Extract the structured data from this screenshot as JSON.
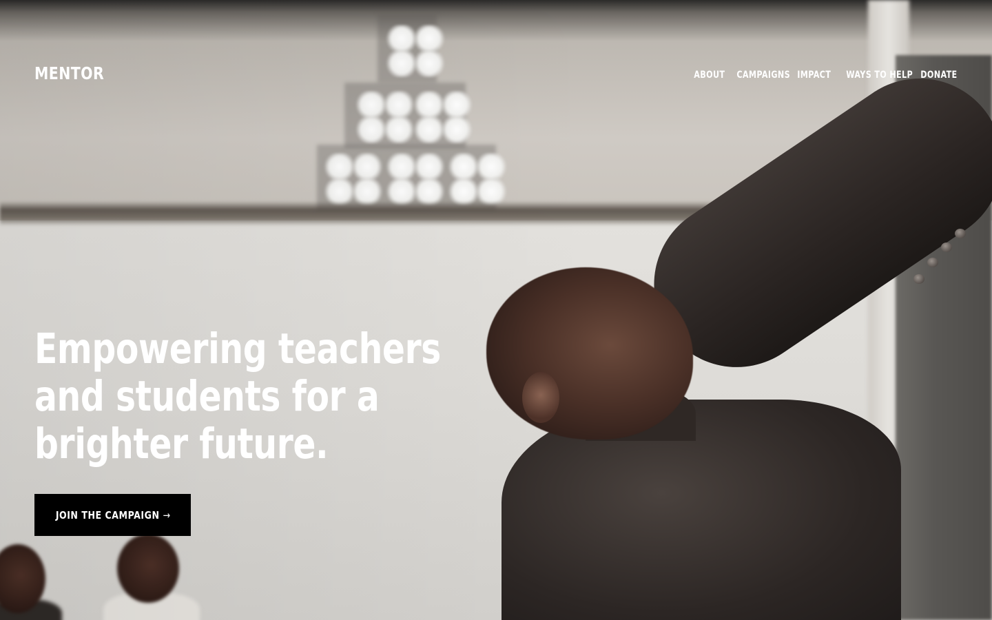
{
  "brand": {
    "logo_text": "MENTOR"
  },
  "nav": {
    "items": [
      {
        "label": "ABOUT"
      },
      {
        "label": "CAMPAIGNS"
      },
      {
        "label": "IMPACT"
      },
      {
        "label": "WAYS TO HELP"
      },
      {
        "label": "DONATE"
      }
    ]
  },
  "hero": {
    "headline": "Empowering teachers and students for a brighter future.",
    "cta_label": "JOIN THE CAMPAIGN",
    "cta_icon": "arrow-right-icon",
    "cta_arrow_glyph": "→"
  },
  "colors": {
    "text": "#ffffff",
    "cta_background": "#000000"
  }
}
